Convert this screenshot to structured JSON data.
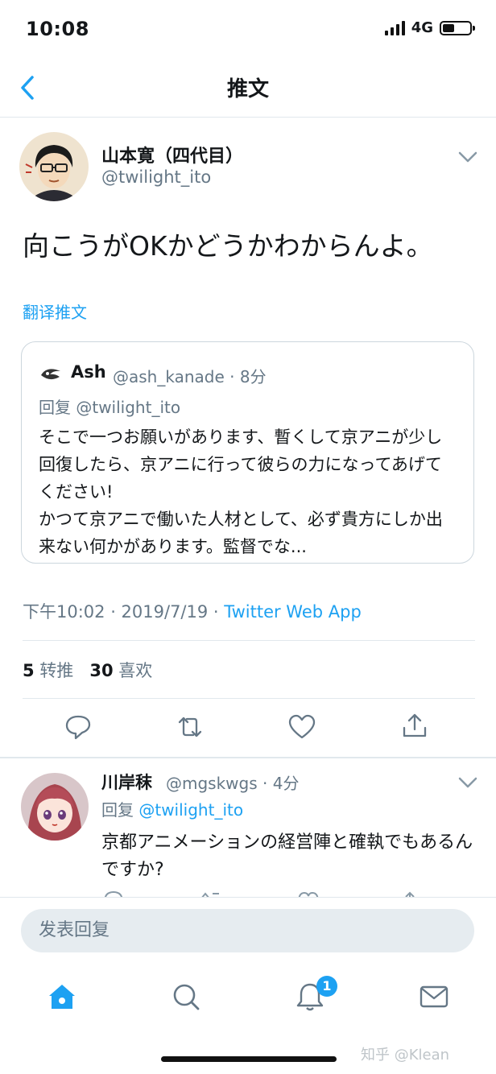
{
  "status_bar": {
    "time": "10:08",
    "network": "4G"
  },
  "nav": {
    "title": "推文"
  },
  "tweet": {
    "author_name": "山本寛（四代目）",
    "author_handle": "@twilight_ito",
    "text": "向こうがOKかどうかわからんよ。",
    "translate_label": "翻译推文",
    "quote": {
      "name": "Ash",
      "meta": "@ash_kanade · 8分",
      "reply_prefix": "回复",
      "reply_handle": "@twilight_ito",
      "body": "そこで一つお願いがあります、暫くして京アニが少し回復したら、京アニに行って彼らの力になってあげてください!\nかつて京アニで働いた人材として、必ず貴方にしか出来ない何かがあります。監督でな..."
    },
    "timestamp": "下午10:02 · 2019/7/19 · ",
    "source": "Twitter Web App",
    "retweet_count": "5",
    "retweet_label": "转推",
    "like_count": "30",
    "like_label": "喜欢"
  },
  "reply": {
    "name": "川岸秣",
    "meta": "@mgskwgs · 4分",
    "reply_prefix": "回复",
    "reply_handle": "@twilight_ito",
    "text": "京都アニメーションの経営陣と確執でもあるんですか?"
  },
  "compose": {
    "placeholder": "发表回复"
  },
  "tab_bar": {
    "notification_badge": "1"
  },
  "watermark": "知乎 @Klean",
  "colors": {
    "accent": "#1da1f2",
    "secondary_text": "#657786",
    "divider": "#e1e8ed"
  },
  "icons": [
    "back-icon",
    "chevron-down-icon",
    "reply-icon",
    "retweet-icon",
    "like-icon",
    "share-icon",
    "home-icon",
    "search-icon",
    "notifications-icon",
    "messages-icon"
  ]
}
